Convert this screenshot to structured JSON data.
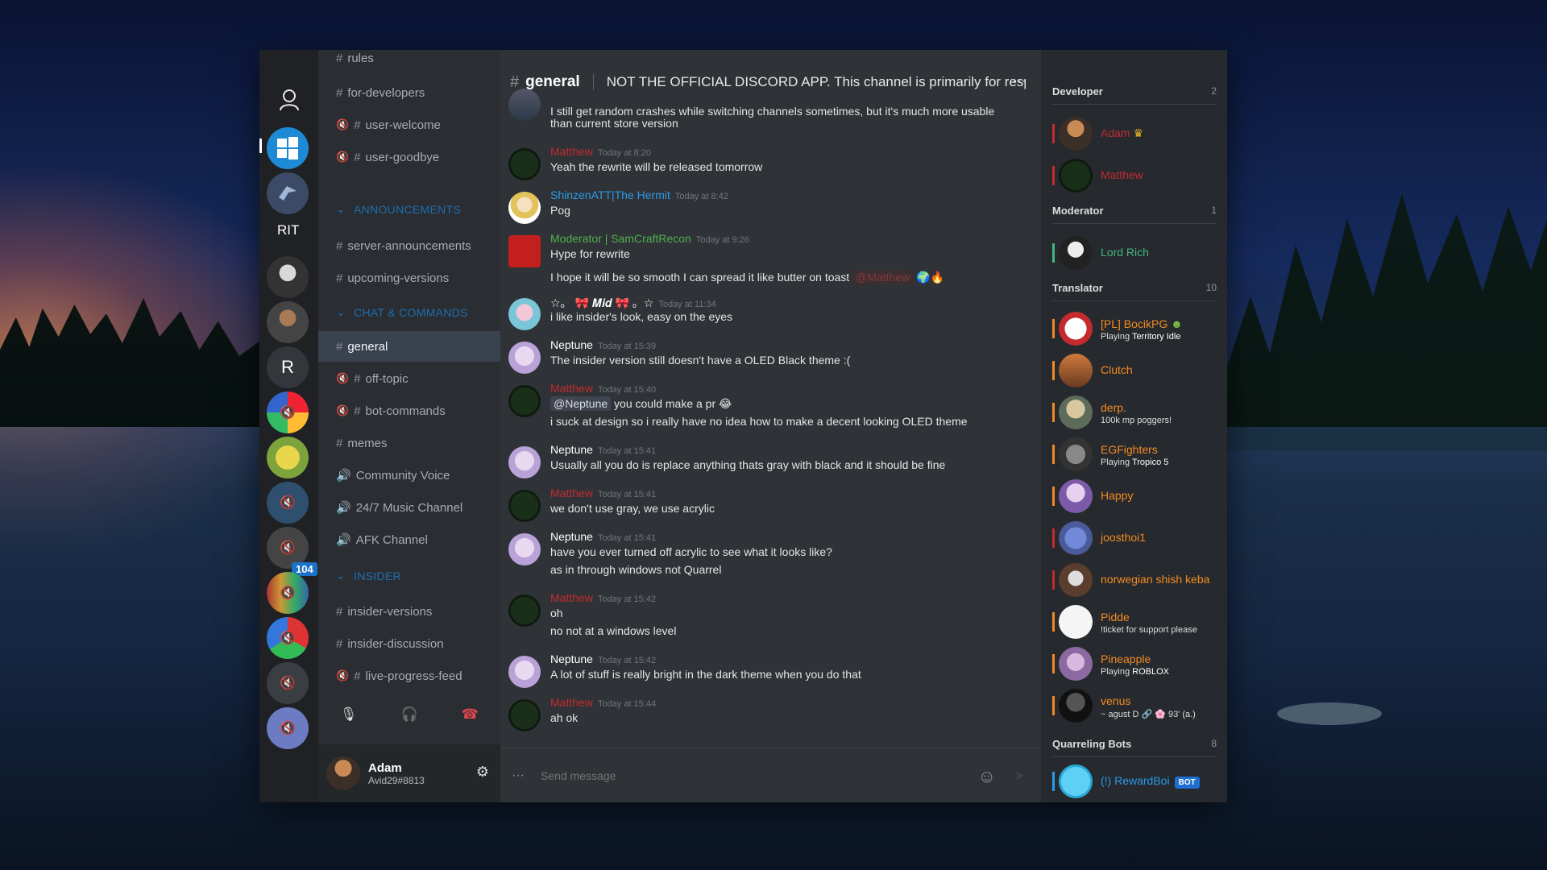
{
  "rail": {
    "rit_label": "RIT",
    "badge": "104"
  },
  "channels": {
    "items": [
      {
        "name": "rules",
        "prefix": "#"
      },
      {
        "name": "for-developers",
        "prefix": "#"
      },
      {
        "name": "user-welcome",
        "prefix": "#",
        "muted": true
      },
      {
        "name": "user-goodbye",
        "prefix": "#",
        "muted": true
      },
      {
        "name": "server-announcements",
        "prefix": "#"
      },
      {
        "name": "upcoming-versions",
        "prefix": "#"
      },
      {
        "name": "general",
        "prefix": "#"
      },
      {
        "name": "off-topic",
        "prefix": "#",
        "muted": true
      },
      {
        "name": "bot-commands",
        "prefix": "#",
        "muted": true
      },
      {
        "name": "memes",
        "prefix": "#"
      },
      {
        "name": "Community Voice",
        "prefix": "🔊"
      },
      {
        "name": "24/7 Music Channel",
        "prefix": "🔊"
      },
      {
        "name": "AFK Channel",
        "prefix": "🔊"
      },
      {
        "name": "insider-versions",
        "prefix": "#"
      },
      {
        "name": "insider-discussion",
        "prefix": "#"
      },
      {
        "name": "live-progress-feed",
        "prefix": "#",
        "muted": true
      }
    ],
    "categories": [
      "ANNOUNCEMENTS",
      "CHAT & COMMANDS",
      "INSIDER"
    ]
  },
  "user": {
    "name": "Adam",
    "tag": "Avid29#8813"
  },
  "chat": {
    "channel": "general",
    "topic": "NOT THE OFFICIAL DISCORD APP. This channel is primarily for resp",
    "placeholder": "Send message",
    "messages": [
      {
        "text": "I still get random crashes while switching channels sometimes, but it's much more usable"
      },
      {
        "text": "than current store version"
      },
      {
        "author": "Matthew",
        "time": "Today at 8:20",
        "text": "Yeah the rewrite will be released tomorrow"
      },
      {
        "author": "ShinzenATT|The Hermit",
        "time": "Today at 8:42",
        "text": "Pog"
      },
      {
        "author": "Moderator | SamCraftRecon",
        "time": "Today at 9:26",
        "text": "Hype for rewrite"
      },
      {
        "text": "I hope it will be so smooth I can spread it like butter on toast",
        "mention": "@Matthew"
      },
      {
        "author": "☆。 🎀 𝑴𝒊𝒅 🎀 。☆",
        "time": "Today at 11:34",
        "text": "i like insider's look, easy on the eyes"
      },
      {
        "author": "Neptune",
        "time": "Today at 15:39",
        "text": "The insider version still doesn't have a OLED Black theme :("
      },
      {
        "author": "Matthew",
        "time": "Today at 15:40",
        "mention": "@Neptune",
        "text": "you could make a pr 😂"
      },
      {
        "text": "i suck at design so i really have no idea how to make a decent looking OLED theme"
      },
      {
        "author": "Neptune",
        "time": "Today at 15:41",
        "text": "Usually all you do is replace anything thats gray with black and it should be fine"
      },
      {
        "author": "Matthew",
        "time": "Today at 15:41",
        "text": "we don't use gray, we use acrylic"
      },
      {
        "author": "Neptune",
        "time": "Today at 15:41",
        "text": "have you ever turned off acrylic to see what it looks like?"
      },
      {
        "text": "as in through windows not Quarrel"
      },
      {
        "author": "Matthew",
        "time": "Today at 15:42",
        "text": "oh"
      },
      {
        "text": "no not at a windows level"
      },
      {
        "author": "Neptune",
        "time": "Today at 15:42",
        "text": "A lot of stuff is really bright in the dark theme when you do that"
      },
      {
        "author": "Matthew",
        "time": "Today at 15:44",
        "text": "ah ok"
      }
    ]
  },
  "members": {
    "groups": [
      {
        "name": "Developer",
        "count": "2"
      },
      {
        "name": "Moderator",
        "count": "1"
      },
      {
        "name": "Translator",
        "count": "10"
      },
      {
        "name": "Quarreling Bots",
        "count": "8"
      }
    ],
    "list": [
      {
        "name": "Adam",
        "status": ""
      },
      {
        "name": "Matthew",
        "status": ""
      },
      {
        "name": "Lord Rich",
        "status": ""
      },
      {
        "name": "[PL] BocikPG",
        "status_prefix": "Playing",
        "status": "Territory Idle"
      },
      {
        "name": "Clutch",
        "status": ""
      },
      {
        "name": "derp.",
        "status": "100k mp poggers!"
      },
      {
        "name": "EGFighters",
        "status_prefix": "Playing",
        "status": "Tropico 5"
      },
      {
        "name": "Happy",
        "status": ""
      },
      {
        "name": "joosthoi1",
        "status": ""
      },
      {
        "name": "norwegian shish keba",
        "status": ""
      },
      {
        "name": "Pidde",
        "status": "!ticket for support please"
      },
      {
        "name": "Pineapple",
        "status_prefix": "Playing",
        "status": "ROBLOX"
      },
      {
        "name": "venus",
        "status": "~ agust D 🔗 🌸 93' (a.)"
      },
      {
        "name": "(!) RewardBoi",
        "badge": "BOT"
      }
    ]
  },
  "colors": {
    "accent": "#1f6fb0",
    "developer": "#c42b2f",
    "moderator": "#43b581",
    "translator": "#f38b24",
    "bot": "#2a9bea"
  }
}
